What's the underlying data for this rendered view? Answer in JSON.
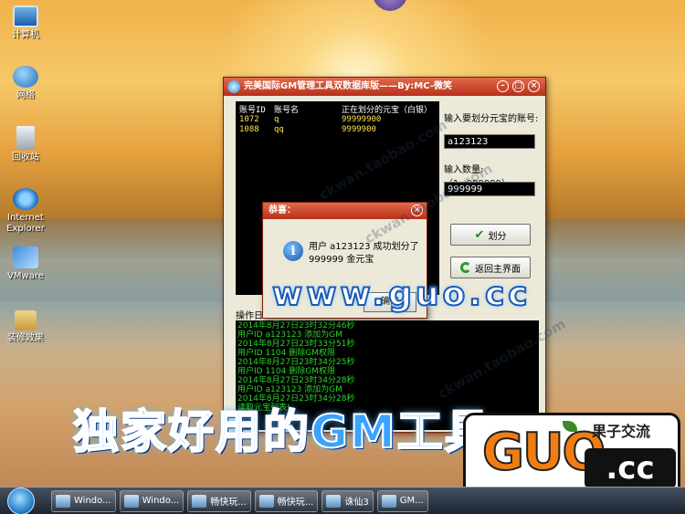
{
  "desktop": {
    "icons": [
      {
        "label": "计算机",
        "icon": "computer-icon"
      },
      {
        "label": "网络",
        "icon": "network-icon"
      },
      {
        "label": "回收站",
        "icon": "recycle-bin-icon"
      },
      {
        "label": "Internet Explorer",
        "icon": "internet-explorer-icon"
      },
      {
        "label": "VMware",
        "icon": "vmware-icon"
      },
      {
        "label": "装修效果",
        "icon": "folder-icon"
      }
    ]
  },
  "window": {
    "title": "完美国际GM管理工具双数据库版——By:MC-微笑",
    "list": {
      "headers": [
        "账号ID",
        "账号名",
        "正在划分的元宝（白银）"
      ],
      "rows": [
        [
          "1072",
          "q",
          "99999900"
        ],
        [
          "1088",
          "qq",
          "9999900"
        ]
      ]
    },
    "account_label": "输入要划分元宝的账号:",
    "account_value": "a123123",
    "amount_label": "输入数量: （1~999999）",
    "amount_value": "999999",
    "allocate_button": "划分",
    "back_button": "返回主界面",
    "log_label": "操作日",
    "log_lines": [
      "2014年8月27日23时32分46秒",
      "用户ID a123123 添加为GM",
      "2014年8月27日23时33分51秒",
      "用户ID 1104 删除GM权限",
      "2014年8月27日23时34分25秒",
      "用户ID 1104 删除GM权限",
      "2014年8月27日23时34分28秒",
      "用户ID a123123 添加为GM",
      "2014年8月27日23时34分28秒",
      "读取元宝列表!"
    ]
  },
  "dialog": {
    "title": "恭喜：",
    "message_line1": "用户 a123123 成功划分了",
    "message_line2": "999999 金元宝",
    "ok_button": "确定"
  },
  "overlay": {
    "watermark": "ckwan.taobao.com",
    "url_text": "www.guo.cc",
    "banner_text": "独家好用的GM工具",
    "logo_big": "GUO",
    "logo_cn": "果子交流",
    "logo_cc": ".cc"
  },
  "taskbar": {
    "items": [
      "Windo...",
      "Windo...",
      "畅快玩...",
      "畅快玩...",
      "诛仙3",
      "GM..."
    ]
  }
}
